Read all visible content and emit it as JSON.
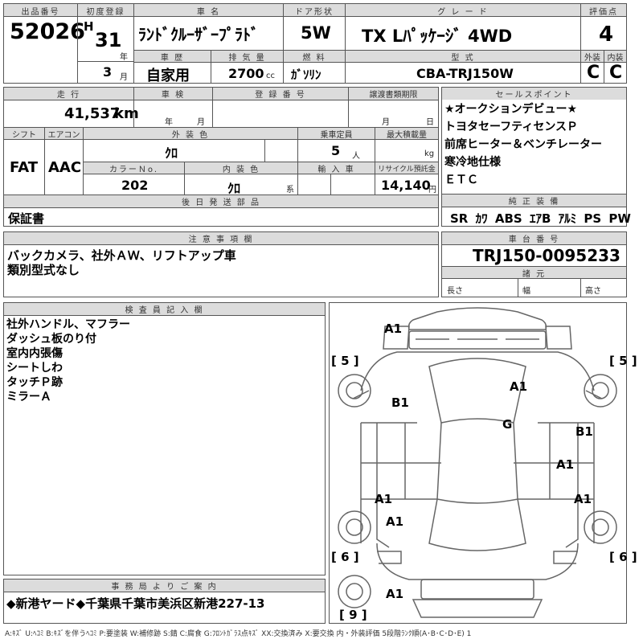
{
  "header": {
    "lot_label": "出品番号",
    "lot_number": "52026",
    "first_reg_label": "初度登録",
    "era": "H",
    "year": "31",
    "year_unit": "年",
    "month": "3",
    "month_unit": "月",
    "car_name_label": "車 名",
    "car_name": "ﾗﾝﾄﾞｸﾙｰｻﾞｰﾌﾟﾗﾄﾞ",
    "doors_label": "ドア形状",
    "doors": "5W",
    "grade_label": "グ レ ー ド",
    "grade": "TX Lﾊﾟｯｹｰｼﾞ 4WD",
    "score_label": "評価点",
    "score": "4",
    "history_label": "車 歴",
    "history": "自家用",
    "displacement_label": "排 気 量",
    "displacement": "2700",
    "displacement_unit": "cc",
    "fuel_label": "燃 料",
    "fuel": "ｶﾞｿﾘﾝ",
    "model_label": "型 式",
    "model_code": "CBA-TRJ150W",
    "exterior_label": "外装",
    "exterior": "C",
    "interior_label": "内装",
    "interior": "C"
  },
  "details": {
    "mileage_label": "走 行",
    "mileage": "41,537",
    "mileage_unit": "km",
    "inspection_label": "車 検",
    "inspection_year": "年",
    "inspection_month": "月",
    "registration_label": "登 録 番 号",
    "transfer_label": "譲渡書類期限",
    "transfer_month": "月",
    "transfer_day": "日",
    "shift_label": "シフト",
    "shift": "FAT",
    "ac_label": "エアコン",
    "ac": "AAC",
    "color_label": "外 装 色",
    "color": "ｸﾛ",
    "capacity_label": "乗車定員",
    "capacity": "5",
    "capacity_unit": "人",
    "load_label": "最大積載量",
    "load_unit": "kg",
    "color_no_label": "カラーＮo.",
    "color_no": "202",
    "int_color_label": "内 装 色",
    "int_color": "ｸﾛ",
    "int_color_unit": "系",
    "import_label": "輸 入 車",
    "recycle_label": "リサイクル預託金",
    "recycle": "14,140",
    "recycle_unit": "円",
    "later_label": "後 日 発 送 部 品",
    "later": "保証書"
  },
  "sales_points": {
    "label": "セールスポイント",
    "items": [
      "★オークションデビュー★",
      "トヨタセーフティセンスＰ",
      "前席ヒーター＆ベンチレーター",
      "寒冷地仕様",
      "ＥＴＣ"
    ]
  },
  "equipment": {
    "label": "純 正 装 備",
    "items": [
      "SR",
      "ｶﾜ",
      "ABS",
      "ｴｱB",
      "ｱﾙﾐ",
      "PS",
      "PW"
    ]
  },
  "notes": {
    "label": "注 意 事 項 欄",
    "lines": [
      "バックカメラ、社外ＡＷ、リフトアップ車",
      "類別型式なし"
    ]
  },
  "chassis": {
    "label": "車 台 番 号",
    "number": "TRJ150-0095233",
    "dims_label": "諸 元",
    "length": "長さ",
    "width": "幅",
    "height": "高さ"
  },
  "inspector": {
    "label": "検 査 員 記 入 欄",
    "lines": [
      "社外ハンドル、マフラー",
      "ダッシュ板のり付",
      "室内内張傷",
      "シートしわ",
      "タッチＰ跡",
      "ミラーＡ"
    ]
  },
  "office": {
    "label": "事 務 局 よ り ご 案 内",
    "text": "◆新港ヤード◆千葉県千葉市美浜区新港227-13"
  },
  "diagram": {
    "marks": [
      "A1",
      "A1",
      "B1",
      "G",
      "B1",
      "A1",
      "A1",
      "A1",
      "A1",
      "A1"
    ],
    "tire_depths": [
      "5",
      "5",
      "6",
      "6",
      "9"
    ]
  },
  "legend": "A:ｷｽﾞ U:ﾍｺﾐ B:ｷｽﾞを伴うﾍｺﾐ P:要塗装 W:補修跡 S:錆 C:腐食 G:ﾌﾛﾝﾄｶﾞﾗｽ点ｷｽﾞ XX:交換済み X:要交換 内・外装評価 5段階ﾗﾝｸ順(A･B･C･D･E) 1"
}
